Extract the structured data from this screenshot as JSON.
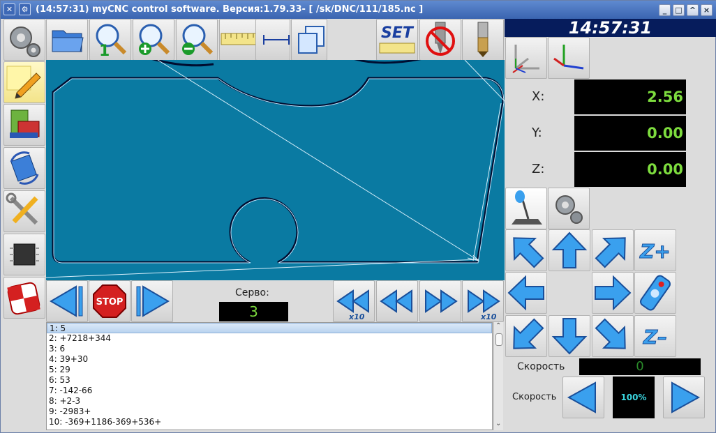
{
  "titlebar": {
    "title": "(14:57:31)   myCNC control software. Версия:1.79.33-   [ /sk/DNC/111/185.nc ]",
    "buttons": [
      "_",
      "□",
      "^",
      "×"
    ]
  },
  "toolbar": {
    "set_label": "SET",
    "zoom_one_label": "1"
  },
  "clock": "14:57:31",
  "dro": {
    "x_label": "X:",
    "x_value": "2.56",
    "y_label": "Y:",
    "y_value": "0.00",
    "z_label": "Z:",
    "z_value": "0.00"
  },
  "jog": {
    "z_plus_label": "Z+",
    "z_minus_label": "Z–"
  },
  "speed": {
    "label1": "Скорость",
    "value1": "0",
    "label2": "Скорость",
    "percent": "100%"
  },
  "servo": {
    "label": "Серво:",
    "value": "3"
  },
  "playback": {
    "stop_label": "STOP",
    "x10_label": "x10"
  },
  "program_lines": [
    "1: 5",
    "2: +7218+344",
    "3: 6",
    "4: 39+30",
    "5: 29",
    "6: 53",
    "7: -142-66",
    "8: +2-3",
    "9: -2983+",
    "10: -369+1186-369+536+"
  ],
  "colors": {
    "canvas_bg": "#0a7aa2",
    "clock_bg": "#061c5c",
    "dro_text": "#7ddc3e",
    "arrow_blue": "#3aa0ee"
  }
}
